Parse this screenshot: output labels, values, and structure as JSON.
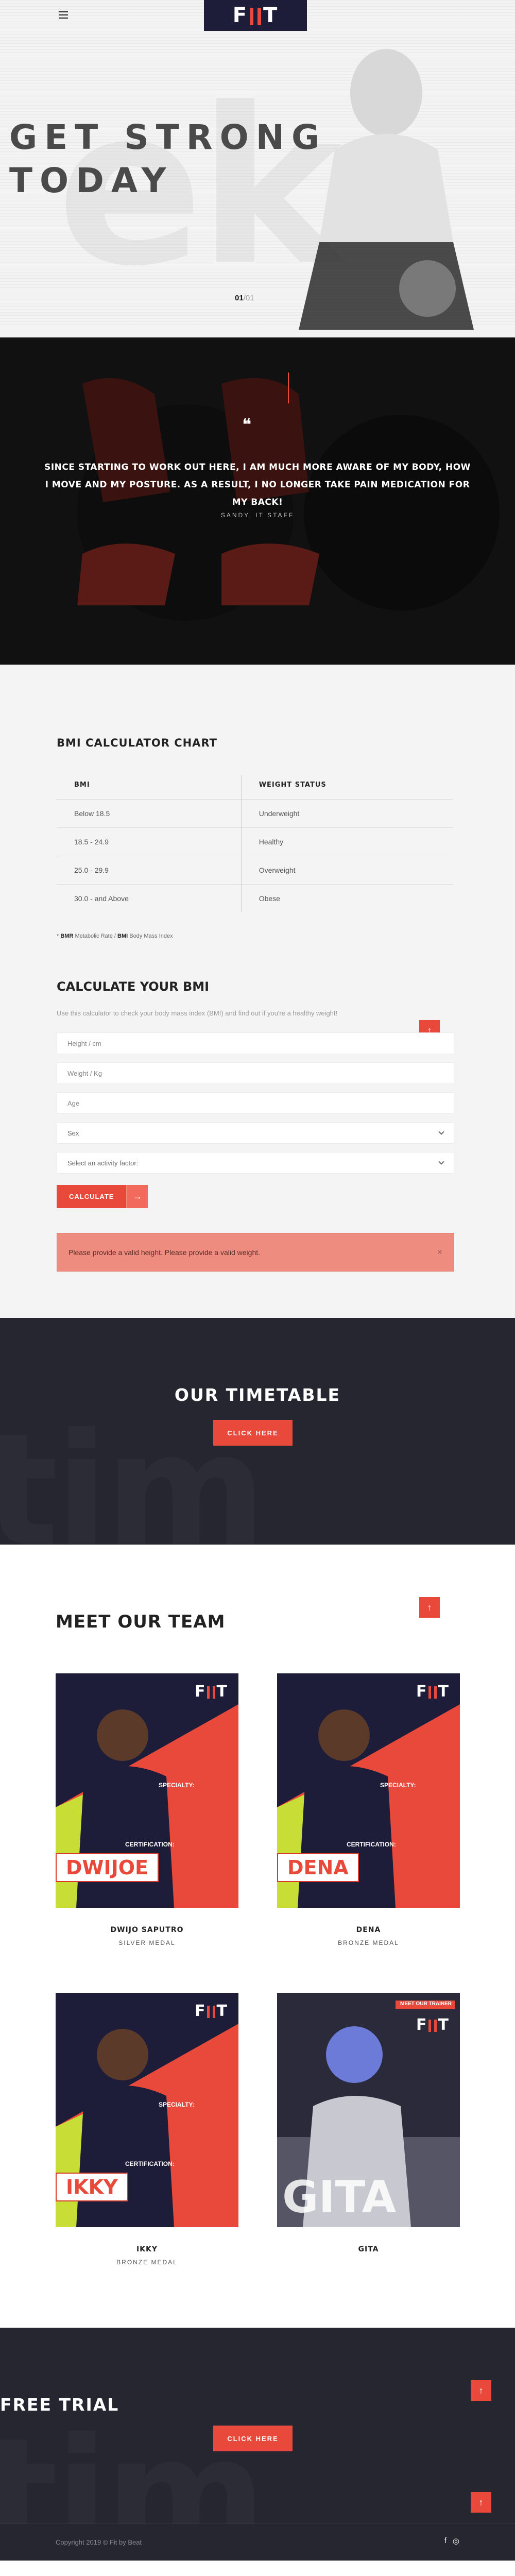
{
  "header": {
    "logo_text": "FIT",
    "colors": {
      "brand": "#1d1d3a",
      "accent": "#e8493a"
    }
  },
  "hero": {
    "title_line1": "GET STRONG",
    "title_line2": "TODAY",
    "bg_letters": "ek",
    "slide_current": "01",
    "slide_total": "/01"
  },
  "testimonial": {
    "quote_mark": "❝",
    "text": "SINCE STARTING TO WORK OUT HERE, I AM MUCH MORE AWARE OF MY BODY, HOW I MOVE AND MY POSTURE. AS A RESULT, I NO LONGER TAKE PAIN MEDICATION FOR MY BACK!",
    "author": "SANDY, IT STAFF"
  },
  "bmi": {
    "chart_title": "BMI CALCULATOR CHART",
    "headers": [
      "BMI",
      "WEIGHT STATUS"
    ],
    "rows": [
      [
        "Below 18.5",
        "Underweight"
      ],
      [
        "18.5 - 24.9",
        "Healthy"
      ],
      [
        "25.0 - 29.9",
        "Overweight"
      ],
      [
        "30.0 - and Above",
        "Obese"
      ]
    ],
    "note_bmr": "BMR",
    "note_bmr_text": " Metabolic Rate / ",
    "note_bmi": "BMI",
    "note_bmi_text": " Body Mass Index",
    "calc_title": "CALCULATE YOUR BMI",
    "calc_desc": "Use this calculator to check your body mass index (BMI) and find out if you're a healthy weight!",
    "height_placeholder": "Height / cm",
    "weight_placeholder": "Weight / Kg",
    "age_placeholder": "Age",
    "sex_label": "Sex",
    "activity_label": "Select an activity factor:",
    "calc_button": "CALCULATE",
    "alert": "Please provide a valid height. Please provide a valid weight.",
    "alert_close": "×"
  },
  "timetable": {
    "title": "OUR TIMETABLE",
    "button": "CLICK HERE",
    "bg_word": "tim"
  },
  "team": {
    "title": "MEET OUR TEAM",
    "card_labels": {
      "specialty": "SPECIALTY:",
      "certification": "CERTIFICATION:",
      "gita_badge": "MEET OUR TRAINER"
    },
    "members": [
      {
        "card_name": "DWIJOE",
        "name": "DWIJO SAPUTRO",
        "role": "SILVER MEDAL"
      },
      {
        "card_name": "DENA",
        "name": "DENA",
        "role": "BRONZE MEDAL"
      },
      {
        "card_name": "IKKY",
        "name": "IKKY",
        "role": "BRONZE MEDAL"
      },
      {
        "card_name": "GITA",
        "name": "GITA",
        "role": ""
      }
    ]
  },
  "trial": {
    "title": "FREE TRIAL",
    "button": "CLICK HERE",
    "bg_word": "tim"
  },
  "footer": {
    "copyright": "Copyright 2019 © Fit by Beat",
    "social": [
      "f",
      "◎"
    ]
  },
  "scroll_top_icon": "↑",
  "arrow_icon": "→"
}
